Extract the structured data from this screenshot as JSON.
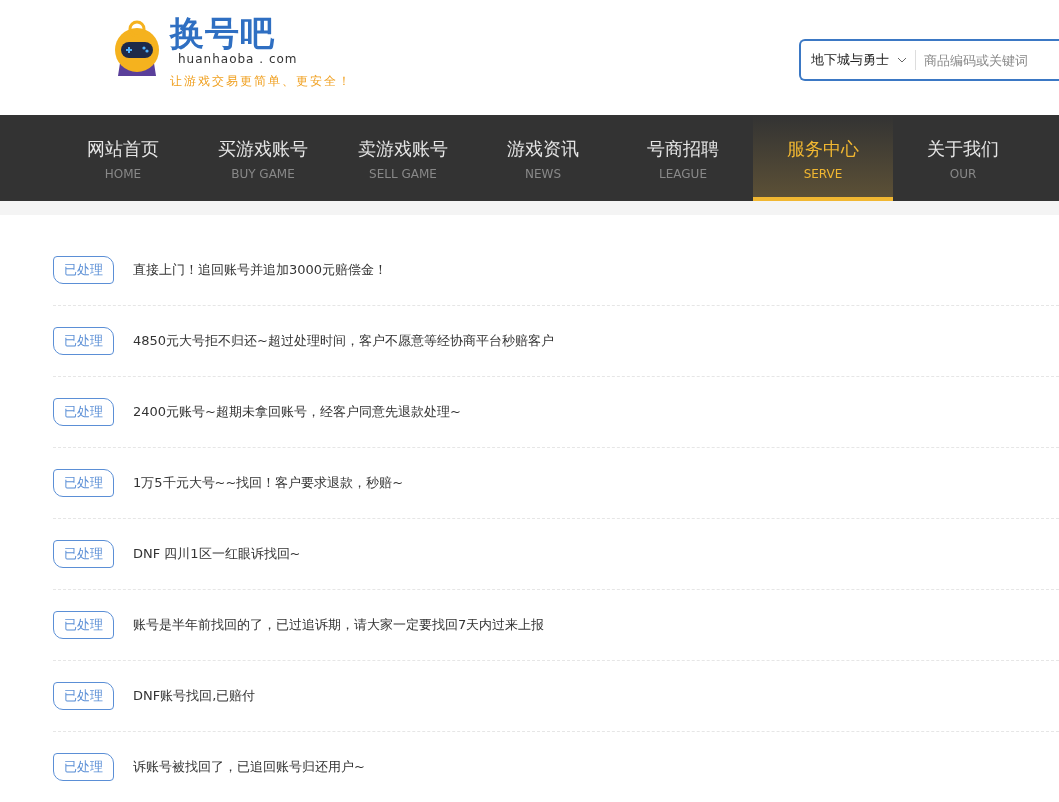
{
  "logo": {
    "name": "换号吧",
    "domain": "huanhaoba . com",
    "slogan": "让游戏交易更简单、更安全！"
  },
  "search": {
    "game": "地下城与勇士",
    "placeholder": "商品编码或关键词"
  },
  "nav": [
    {
      "label": "网站首页",
      "sub": "HOME",
      "selected": false
    },
    {
      "label": "买游戏账号",
      "sub": "BUY GAME",
      "selected": false
    },
    {
      "label": "卖游戏账号",
      "sub": "SELL GAME",
      "selected": false
    },
    {
      "label": "游戏资讯",
      "sub": "NEWS",
      "selected": false
    },
    {
      "label": "号商招聘",
      "sub": "LEAGUE",
      "selected": false
    },
    {
      "label": "服务中心",
      "sub": "SERVE",
      "selected": true
    },
    {
      "label": "关于我们",
      "sub": "OUR",
      "selected": false
    }
  ],
  "cases": [
    {
      "status": "已处理",
      "title": "直接上门！追回账号并追加3000元赔偿金！"
    },
    {
      "status": "已处理",
      "title": "4850元大号拒不归还~超过处理时间，客户不愿意等经协商平台秒赔客户"
    },
    {
      "status": "已处理",
      "title": "2400元账号~超期未拿回账号，经客户同意先退款处理~"
    },
    {
      "status": "已处理",
      "title": "1万5千元大号~~找回！客户要求退款，秒赔~"
    },
    {
      "status": "已处理",
      "title": "DNF 四川1区一红眼诉找回~"
    },
    {
      "status": "已处理",
      "title": "账号是半年前找回的了，已过追诉期，请大家一定要找回7天内过来上报"
    },
    {
      "status": "已处理",
      "title": "DNF账号找回,已赔付"
    },
    {
      "status": "已处理",
      "title": "诉账号被找回了，已追回账号归还用户~"
    }
  ]
}
